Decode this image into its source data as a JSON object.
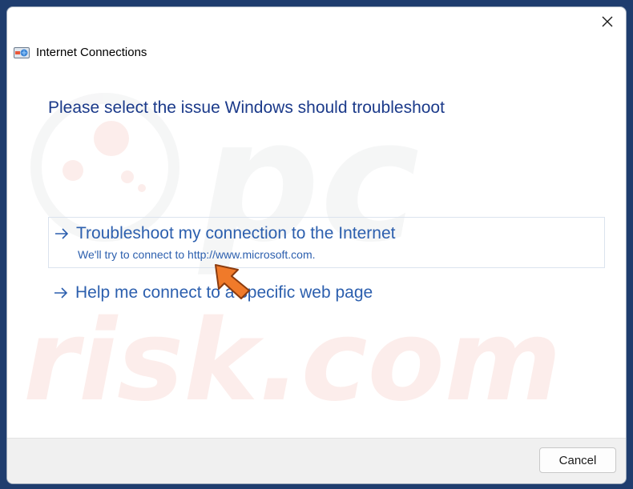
{
  "window": {
    "title": "Internet Connections",
    "icon": "network-troubleshooter-icon",
    "close_icon": "close-icon"
  },
  "heading": "Please select the issue Windows should troubleshoot",
  "options": [
    {
      "label": "Troubleshoot my connection to the Internet",
      "description": "We'll try to connect to http://www.microsoft.com.",
      "icon": "arrow-right-icon",
      "selected": true
    },
    {
      "label": "Help me connect to a specific web page",
      "icon": "arrow-right-icon",
      "selected": false
    }
  ],
  "footer": {
    "cancel_label": "Cancel"
  },
  "annotation": {
    "icon": "pointer-arrow-icon",
    "color": "#f07a2a"
  },
  "watermark": {
    "text": "pc risk.com"
  },
  "colors": {
    "heading": "#1b3a8a",
    "link": "#2c5fae",
    "desktop": "#1f3d6e"
  }
}
